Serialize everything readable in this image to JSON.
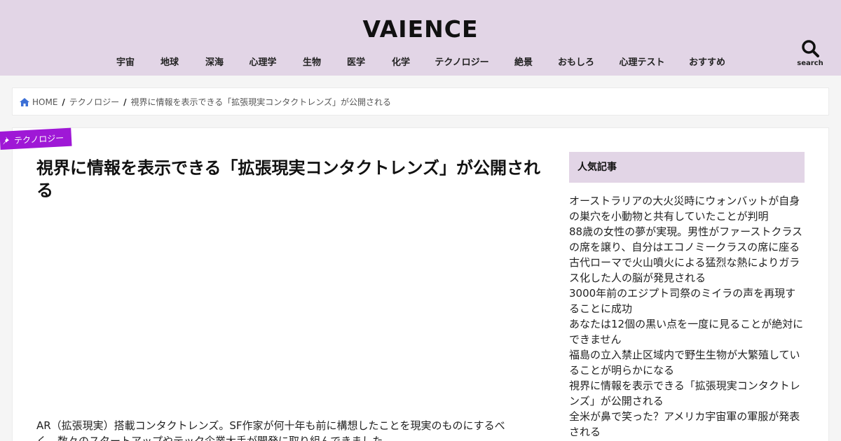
{
  "site": {
    "logo": "VAIENCE"
  },
  "nav": {
    "items": [
      "宇宙",
      "地球",
      "深海",
      "心理学",
      "生物",
      "医学",
      "化学",
      "テクノロジー",
      "絶景",
      "おもしろ",
      "心理テスト",
      "おすすめ"
    ],
    "search_label": "search"
  },
  "breadcrumb": {
    "home": "HOME",
    "category": "テクノロジー",
    "current": "視界に情報を表示できる「拡張現実コンタクトレンズ」が公開される",
    "separator": "/"
  },
  "article": {
    "category": "テクノロジー",
    "title": "視界に情報を表示できる「拡張現実コンタクトレンズ」が公開される",
    "body_line1": "AR（拡張現実）搭載コンタクトレンズ。SF作家が何十年も前に構想したことを現実のものにするべ",
    "body_line2": "く、数々のスタートアップやテック企業大手が開発に取り組んできました。"
  },
  "sidebar": {
    "widget_title": "人気記事",
    "popular": [
      "オーストラリアの大火災時にウォンバットが自身の巣穴を小動物と共有していたことが判明",
      "88歳の女性の夢が実現。男性がファーストクラスの席を譲り、自分はエコノミークラスの席に座る",
      "古代ローマで火山噴火による猛烈な熱によりガラス化した人の脳が発見される",
      "3000年前のエジプト司祭のミイラの声を再現することに成功",
      "あなたは12個の黒い点を一度に見ることが絶対にできません",
      "福島の立入禁止区域内で野生生物が大繁殖していることが明らかになる",
      "視界に情報を表示できる「拡張現実コンタクトレンズ」が公開される",
      "全米が鼻で笑った？アメリカ宇宙軍の軍服が発表される"
    ]
  },
  "colors": {
    "header_bg": "#e2d5e6",
    "category_badge": "#9f18d6",
    "breadcrumb_icon": "#3c6fd6"
  },
  "icons": {
    "search": "search-icon",
    "home": "home-icon",
    "pin": "pin-icon"
  }
}
